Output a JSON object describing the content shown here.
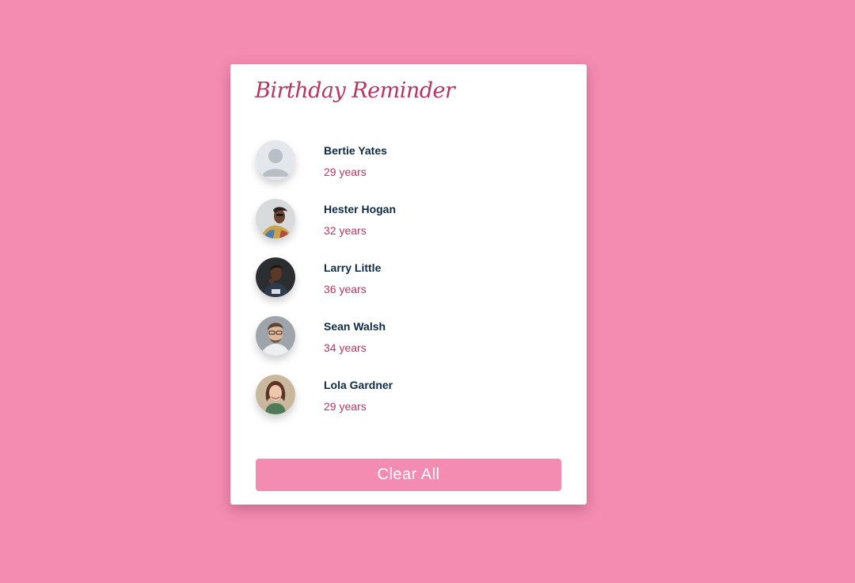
{
  "app": {
    "title": "Birthday Reminder"
  },
  "people": [
    {
      "name": "Bertie Yates",
      "age": "29 years",
      "avatar_icon": "default-user-icon"
    },
    {
      "name": "Hester Hogan",
      "age": "32 years",
      "avatar_icon": "person-photo"
    },
    {
      "name": "Larry Little",
      "age": "36 years",
      "avatar_icon": "person-photo"
    },
    {
      "name": "Sean Walsh",
      "age": "34 years",
      "avatar_icon": "person-photo"
    },
    {
      "name": "Lola Gardner",
      "age": "29 years",
      "avatar_icon": "person-photo"
    }
  ],
  "actions": {
    "clear_label": "Clear All"
  },
  "colors": {
    "background": "#f48bb1",
    "accent": "#b8355f",
    "name_text": "#102a43",
    "button": "#f48bb1"
  }
}
